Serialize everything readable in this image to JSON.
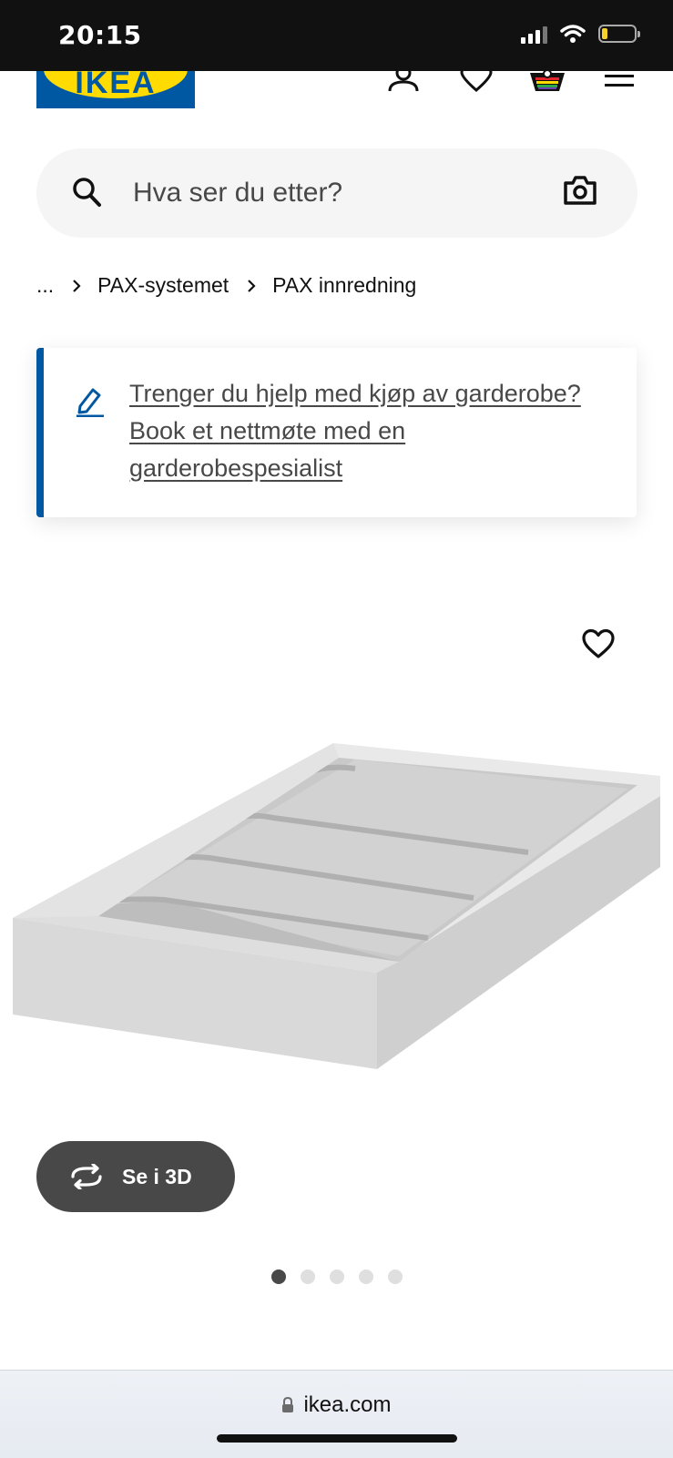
{
  "status": {
    "time": "20:15"
  },
  "header": {
    "logo_text": "IKEA"
  },
  "search": {
    "placeholder": "Hva ser du etter?"
  },
  "breadcrumb": {
    "ellipsis": "...",
    "items": [
      "PAX-systemet",
      "PAX innredning"
    ]
  },
  "info": {
    "link_text": "Trenger du hjelp med kjøp av garderobe? Book et nettmøte med en garderobespesialist"
  },
  "gallery": {
    "view_3d_label": "Se i 3D",
    "image_count": 5,
    "current_index": 1
  },
  "browser": {
    "url": "ikea.com"
  },
  "colors": {
    "brand_blue": "#0058a3",
    "brand_yellow": "#ffdb00",
    "button_dark": "#484848"
  }
}
